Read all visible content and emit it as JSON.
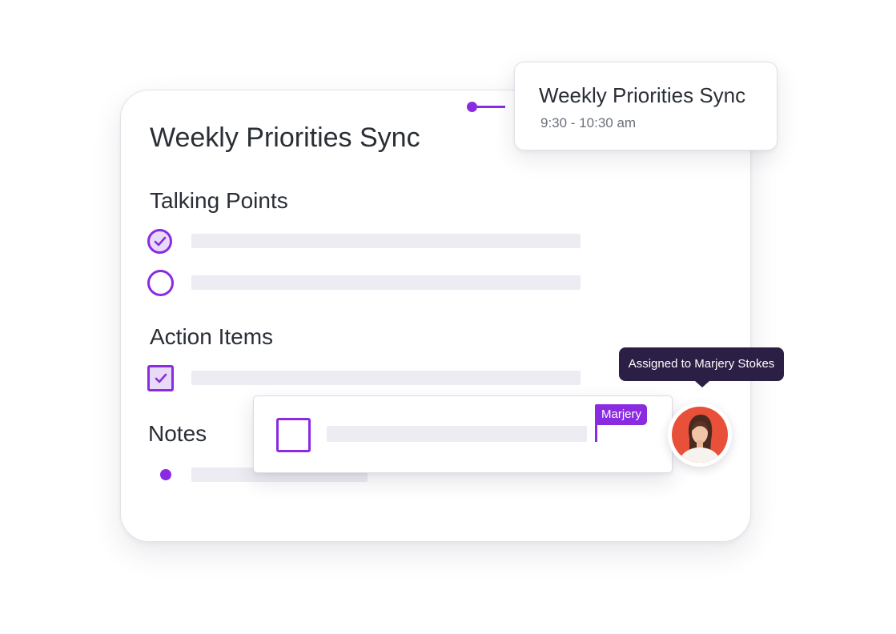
{
  "document": {
    "title": "Weekly Priorities Sync",
    "sections": {
      "talking_points": "Talking Points",
      "action_items": "Action Items",
      "notes": "Notes"
    },
    "talking_point_states": [
      "checked",
      "unchecked"
    ],
    "action_item_states": [
      "checked"
    ]
  },
  "event": {
    "title": "Weekly Priorities Sync",
    "time": "9:30 - 10:30 am"
  },
  "assignment": {
    "tooltip": "Assigned to Marjery Stokes",
    "cursor_label": "Marjery",
    "checkbox_state": "unchecked"
  },
  "icons": {
    "check": "check-icon",
    "avatar": "avatar-photo"
  },
  "colors": {
    "accent": "#8a2be2",
    "accent_light": "#e8dbf7",
    "tooltip_bg": "#2c1f45",
    "placeholder": "#ececf2",
    "avatar_bg": "#e8503a"
  }
}
